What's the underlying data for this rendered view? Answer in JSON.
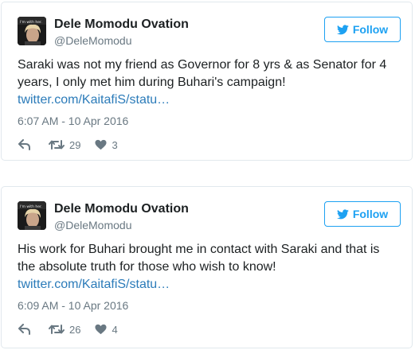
{
  "tweets": [
    {
      "name": "Dele Momodu Ovation",
      "handle": "@DeleMomodu",
      "follow_label": "Follow",
      "avatar_text": "I'm with her.",
      "text_lines": [
        "Saraki was not my friend as Governor for 8 yrs & as Senator for 4",
        "years, I only met him during Buhari's campaign!"
      ],
      "link": "twitter.com/KaitafiS/statu…",
      "timestamp": "6:07 AM - 10 Apr 2016",
      "retweets": "29",
      "likes": "3"
    },
    {
      "name": "Dele Momodu Ovation",
      "handle": "@DeleMomodu",
      "follow_label": "Follow",
      "avatar_text": "I'm with her.",
      "text_lines": [
        "His work for Buhari brought me in contact with Saraki and that is",
        "the absolute truth for those who wish to know!"
      ],
      "link": "twitter.com/KaitafiS/statu…",
      "timestamp": "6:09 AM - 10 Apr 2016",
      "retweets": "26",
      "likes": "4"
    }
  ],
  "icons": {
    "reply": "reply-icon",
    "retweet": "retweet-icon",
    "like": "heart-icon",
    "follow": "twitter-bird-icon"
  },
  "colors": {
    "accent": "#1da1f2",
    "link": "#2b7bb9",
    "muted": "#697882",
    "border": "#e1e8ed"
  }
}
